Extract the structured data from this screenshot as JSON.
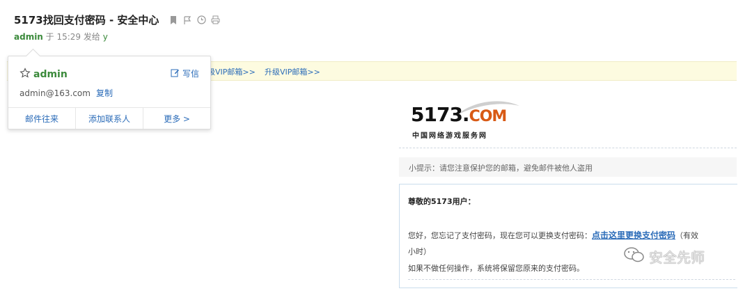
{
  "mail": {
    "subject": "5173找回支付密码 - 安全中心",
    "sender": "admin",
    "meta_mid": " 于 15:29 发给 ",
    "recipient": "y"
  },
  "vip_bar": {
    "partial_link": "级VIP邮箱>>",
    "upgrade_link": "升级VIP邮箱>>"
  },
  "contact_card": {
    "name": "admin",
    "write_label": "写信",
    "email": "admin@163.com",
    "copy_label": "复制",
    "actions": [
      "邮件往来",
      "添加联系人",
      "更多 >"
    ]
  },
  "brand": {
    "logo_main": "5173.",
    "logo_com": "COM",
    "logo_sub": "中国网络游戏服务网"
  },
  "tip": "小提示：请您注意保护您的邮箱，避免邮件被他人盗用",
  "body": {
    "greeting": "尊敬的5173用户：",
    "line1_prefix": "您好，您忘记了支付密码，现在您可以更换支付密码：",
    "line1_link": "点击这里更换支付密码",
    "line1_suffix": "（有效",
    "line2": "小时）",
    "line3": "如果不做任何操作，系统将保留您原来的支付密码。"
  },
  "watermark": "安全先师",
  "colors": {
    "green": "#3b8a3b",
    "link_blue": "#2a6bb8",
    "vip_bg": "#fdfbe0",
    "logo_orange": "#d85a15"
  },
  "icons": [
    "bookmark-icon",
    "flag-icon",
    "clock-icon",
    "print-icon",
    "star-icon",
    "edit-icon",
    "wechat-icon"
  ]
}
